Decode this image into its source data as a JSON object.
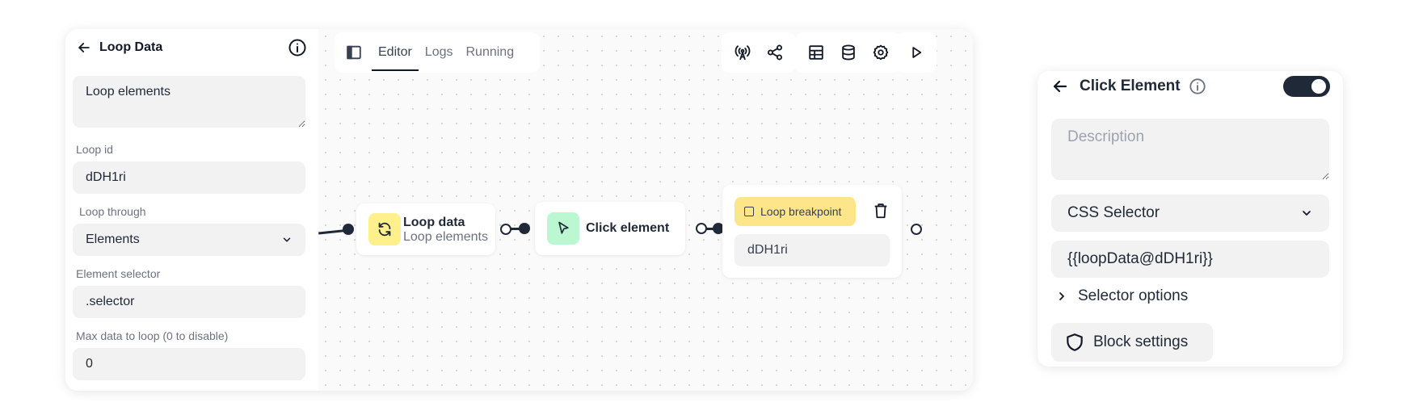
{
  "left_panel": {
    "title": "Loop Data",
    "description": "Loop elements",
    "loop_id_label": "Loop id",
    "loop_id_value": "dDH1ri",
    "loop_through_label": "Loop through",
    "loop_through_value": "Elements",
    "element_selector_label": "Element selector",
    "element_selector_value": ".selector",
    "max_data_label": "Max data to loop (0 to disable)",
    "max_data_value": "0"
  },
  "tabs": [
    {
      "label": "Editor",
      "active": true
    },
    {
      "label": "Logs",
      "active": false
    },
    {
      "label": "Running",
      "active": false
    }
  ],
  "toolbar_icons": [
    "broadcast-icon",
    "share-icon",
    "table-icon",
    "database-icon",
    "settings-icon",
    "play-icon"
  ],
  "nodes": {
    "loop_data": {
      "title": "Loop data",
      "subtitle": "Loop elements",
      "icon": "refresh-icon",
      "icon_bg": "#fef08a"
    },
    "click_element": {
      "title": "Click element",
      "icon": "cursor-icon",
      "icon_bg": "#bbf7d0"
    },
    "loop_breakpoint": {
      "badge": "Loop breakpoint",
      "value": "dDH1ri",
      "badge_bg": "#fde68a"
    }
  },
  "right_panel": {
    "title": "Click Element",
    "toggle_on": true,
    "description_placeholder": "Description",
    "selector_type": "CSS Selector",
    "selector_value": "{{loopData@dDH1ri}}",
    "selector_options_label": "Selector options",
    "block_settings_label": "Block settings"
  }
}
